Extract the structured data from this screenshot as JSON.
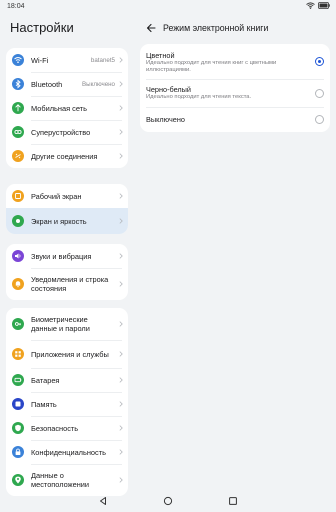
{
  "status_bar": {
    "time": "18:04"
  },
  "left_panel": {
    "title": "Настройки",
    "groups": [
      [
        {
          "label": "Wi-Fi",
          "value": "batanet5",
          "icon": "wifi-icon",
          "color": "#3b82d8"
        },
        {
          "label": "Bluetooth",
          "value": "Выключено",
          "icon": "bluetooth-icon",
          "color": "#3b82d8"
        },
        {
          "label": "Мобильная сеть",
          "value": "",
          "icon": "mobile-network-icon",
          "color": "#2fa84f"
        },
        {
          "label": "Суперустройство",
          "value": "",
          "icon": "super-device-icon",
          "color": "#2fa84f"
        },
        {
          "label": "Другие соединения",
          "value": "",
          "icon": "link-icon",
          "color": "#f0a21f"
        }
      ],
      [
        {
          "label": "Рабочий экран",
          "value": "",
          "icon": "home-screen-icon",
          "color": "#f0a21f"
        },
        {
          "label": "Экран и яркость",
          "value": "",
          "icon": "display-icon",
          "color": "#2fa84f",
          "selected": true
        }
      ],
      [
        {
          "label": "Звуки и вибрация",
          "value": "",
          "icon": "sound-icon",
          "color": "#7b45d6"
        },
        {
          "label": "Уведомления и строка состояния",
          "value": "",
          "icon": "bell-icon",
          "color": "#f0a21f"
        }
      ],
      [
        {
          "label": "Биометрические данные и пароли",
          "value": "",
          "icon": "key-icon",
          "color": "#2fa84f"
        },
        {
          "label": "Приложения и службы",
          "value": "",
          "icon": "apps-icon",
          "color": "#f0a21f"
        },
        {
          "label": "Батарея",
          "value": "",
          "icon": "battery-icon",
          "color": "#2fa84f"
        },
        {
          "label": "Память",
          "value": "",
          "icon": "storage-icon",
          "color": "#2a46c8"
        },
        {
          "label": "Безопасность",
          "value": "",
          "icon": "shield-icon",
          "color": "#2fa84f"
        },
        {
          "label": "Конфиденциальность",
          "value": "",
          "icon": "privacy-icon",
          "color": "#3b82d8"
        },
        {
          "label": "Данные о местоположении",
          "value": "",
          "icon": "location-icon",
          "color": "#2fa84f"
        }
      ]
    ]
  },
  "right_panel": {
    "title": "Режим электронной книги",
    "options": [
      {
        "title": "Цветной",
        "description": "Идеально подходит для чтения книг с цветными иллюстрациями.",
        "selected": true
      },
      {
        "title": "Черно-белый",
        "description": "Идеально подходит для чтения текста.",
        "selected": false
      },
      {
        "title": "Выключено",
        "description": "",
        "selected": false
      }
    ]
  },
  "colors": {
    "accent": "#1f56d6",
    "selected_row": "#dfeaf6"
  }
}
